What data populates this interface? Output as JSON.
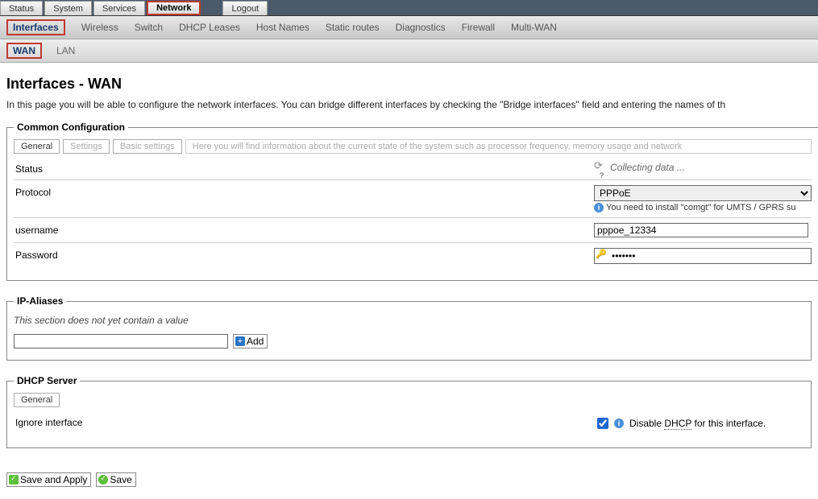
{
  "topnav": {
    "items": [
      {
        "label": "Status"
      },
      {
        "label": "System"
      },
      {
        "label": "Services"
      },
      {
        "label": "Network"
      },
      {
        "label": "Logout"
      }
    ]
  },
  "subnav": {
    "items": [
      {
        "label": "Interfaces"
      },
      {
        "label": "Wireless"
      },
      {
        "label": "Switch"
      },
      {
        "label": "DHCP Leases"
      },
      {
        "label": "Host Names"
      },
      {
        "label": "Static routes"
      },
      {
        "label": "Diagnostics"
      },
      {
        "label": "Firewall"
      },
      {
        "label": "Multi-WAN"
      }
    ]
  },
  "subsubnav": {
    "items": [
      {
        "label": "WAN"
      },
      {
        "label": "LAN"
      }
    ]
  },
  "page": {
    "title": "Interfaces - WAN",
    "description": "In this page you will be able to configure the network interfaces. You can bridge different interfaces by checking the \"Bridge interfaces\" field and entering the names of th"
  },
  "common": {
    "legend": "Common Configuration",
    "tabs": {
      "general": "General",
      "settings": "Settings",
      "basic": "Basic settings",
      "note": "Here you will find information about the current state of the system such as processor frequency, memory usage and network"
    },
    "status_label": "Status",
    "status_value": "Collecting data ...",
    "protocol_label": "Protocol",
    "protocol_value": "PPPoE",
    "protocol_hint": "You need to install \"comgt\" for UMTS / GPRS su",
    "username_label": "username",
    "username_value": "pppoe_12334",
    "password_label": "Password",
    "password_value": "•••••••"
  },
  "aliases": {
    "legend": "IP-Aliases",
    "empty": "This section does not yet contain a value",
    "add_label": "Add"
  },
  "dhcp": {
    "legend": "DHCP Server",
    "tab_general": "General",
    "ignore_label": "Ignore interface",
    "disable_pre": "Disable ",
    "disable_acr": "DHCP",
    "disable_post": " for this interface."
  },
  "buttons": {
    "save_apply": "Save and Apply",
    "save": "Save"
  }
}
